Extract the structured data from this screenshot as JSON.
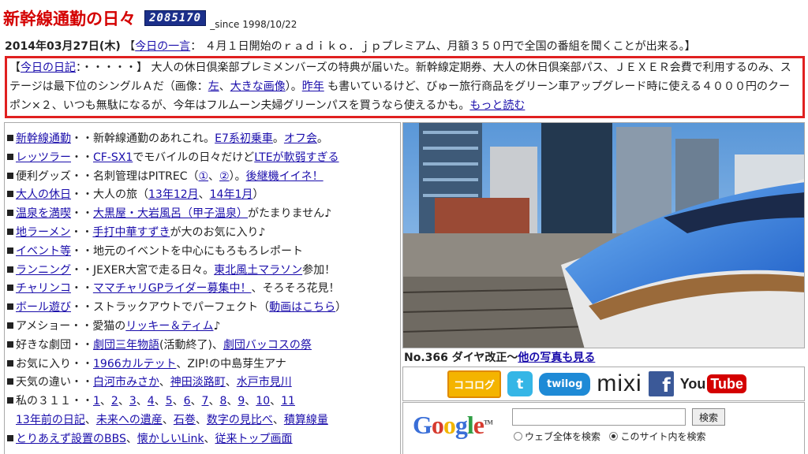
{
  "header": {
    "site_title": "新幹線通勤の日々",
    "counter": "2085170",
    "since": "_since 1998/10/22"
  },
  "today_line": {
    "date": "2014年03月27日(木)",
    "open": "【",
    "phrase_link": "今日の一言",
    "phrase_text": "： ４月１日開始のｒａｄｉｋｏ．ｊｐプレミアム、月額３５０円で全国の番組を聞くことが出来る。】"
  },
  "diary": {
    "open": "【",
    "link": "今日の日記",
    "p1": "：・・・・・】 大人の休日倶楽部プレミメンバーズの特典が届いた。新幹線定期券、大人の休日倶楽部パス、ＪＥＸＥＲ会費で利用するのみ、ステージは最下位のシングルＡだ（画像：",
    "img_left": "左",
    "sep": "、",
    "img_big": "大きな画像",
    "p2": "）。",
    "last_year": "昨年",
    "p3": " も書いているけど、びゅー旅行商品をグリーン車アップグレード時に使える４０００円のクーポン×２、いつも無駄になるが、今年はフルムーン夫婦グリーンパスを買うなら使えるかも。",
    "more": "もっと読む"
  },
  "menu": [
    {
      "label": "新幹線通勤",
      "label_link": true,
      "parts": [
        {
          "t": "・・新幹線通勤のあれこれ。"
        },
        {
          "t": "E7系初乗車",
          "l": true
        },
        {
          "t": "。"
        },
        {
          "t": "オフ会",
          "l": true
        },
        {
          "t": "。"
        }
      ]
    },
    {
      "label": "レッツラー",
      "label_link": true,
      "parts": [
        {
          "t": "・・"
        },
        {
          "t": "CF-SX1",
          "l": true
        },
        {
          "t": "でモバイルの日々だけど"
        },
        {
          "t": "LTEが軟弱すぎる",
          "l": true
        }
      ]
    },
    {
      "label": "便利グッズ",
      "label_link": false,
      "parts": [
        {
          "t": "・・名刺管理はPITREC（"
        },
        {
          "t": "①",
          "l": true
        },
        {
          "t": "、"
        },
        {
          "t": "②",
          "l": true
        },
        {
          "t": "）。"
        },
        {
          "t": "後継機イイネ！",
          "l": true
        }
      ]
    },
    {
      "label": "大人の休日",
      "label_link": true,
      "parts": [
        {
          "t": "・・大人の旅（"
        },
        {
          "t": "13年12月",
          "l": true
        },
        {
          "t": "、"
        },
        {
          "t": "14年1月",
          "l": true
        },
        {
          "t": "）"
        }
      ]
    },
    {
      "label": "温泉を満喫",
      "label_link": true,
      "parts": [
        {
          "t": "・・"
        },
        {
          "t": "大黒屋・大岩風呂（甲子温泉）",
          "l": true
        },
        {
          "t": "がたまりません♪"
        }
      ]
    },
    {
      "label": "地ラーメン",
      "label_link": true,
      "parts": [
        {
          "t": "・・"
        },
        {
          "t": "手打中華すずき",
          "l": true
        },
        {
          "t": "が大のお気に入り♪"
        }
      ]
    },
    {
      "label": "イベント等",
      "label_link": true,
      "parts": [
        {
          "t": "・・地元のイベントを中心にもろもろレポート"
        }
      ]
    },
    {
      "label": "ランニング",
      "label_link": true,
      "parts": [
        {
          "t": "・・JEXER大宮で走る日々。"
        },
        {
          "t": "東北風土マラソン",
          "l": true
        },
        {
          "t": "参加！"
        }
      ]
    },
    {
      "label": "チャリンコ",
      "label_link": true,
      "parts": [
        {
          "t": "・・"
        },
        {
          "t": "ママチャリGPライダー募集中！",
          "l": true
        },
        {
          "t": "、そろそろ花見！"
        }
      ]
    },
    {
      "label": "ボール遊び",
      "label_link": true,
      "parts": [
        {
          "t": "・・ストラックアウトでパーフェクト（"
        },
        {
          "t": "動画はこちら",
          "l": true
        },
        {
          "t": "）"
        }
      ]
    },
    {
      "label": "アメショー",
      "label_link": false,
      "parts": [
        {
          "t": "・・愛猫の"
        },
        {
          "t": "リッキー＆ティム",
          "l": true
        },
        {
          "t": "♪"
        }
      ]
    },
    {
      "label": "好きな劇団",
      "label_link": false,
      "parts": [
        {
          "t": "・・"
        },
        {
          "t": "劇団三年物語",
          "l": true
        },
        {
          "t": "(活動終了)、"
        },
        {
          "t": "劇団バッコスの祭",
          "l": true
        }
      ]
    },
    {
      "label": "お気に入り",
      "label_link": false,
      "parts": [
        {
          "t": "・・"
        },
        {
          "t": "1966カルテット",
          "l": true
        },
        {
          "t": "、ZIP!の中島芽生アナ"
        }
      ]
    },
    {
      "label": "天気の違い",
      "label_link": false,
      "parts": [
        {
          "t": "・・"
        },
        {
          "t": "白河市みさか",
          "l": true
        },
        {
          "t": "、"
        },
        {
          "t": "神田淡路町",
          "l": true
        },
        {
          "t": "、"
        },
        {
          "t": "水戸市見川",
          "l": true
        }
      ]
    },
    {
      "label": "私の３１１",
      "label_link": false,
      "parts": [
        {
          "t": "・・"
        },
        {
          "t": "1",
          "l": true
        },
        {
          "t": "、"
        },
        {
          "t": "2",
          "l": true
        },
        {
          "t": "、"
        },
        {
          "t": "3",
          "l": true
        },
        {
          "t": "、"
        },
        {
          "t": "4",
          "l": true
        },
        {
          "t": "、"
        },
        {
          "t": "5",
          "l": true
        },
        {
          "t": "、"
        },
        {
          "t": "6",
          "l": true
        },
        {
          "t": "、"
        },
        {
          "t": "7",
          "l": true
        },
        {
          "t": "、"
        },
        {
          "t": "8",
          "l": true
        },
        {
          "t": "、"
        },
        {
          "t": "9",
          "l": true
        },
        {
          "t": "、"
        },
        {
          "t": "10",
          "l": true
        },
        {
          "t": "、"
        },
        {
          "t": "11",
          "l": true
        }
      ]
    },
    {
      "label": "",
      "label_link": false,
      "parts": [
        {
          "t": "13年前の日記",
          "l": true
        },
        {
          "t": "、"
        },
        {
          "t": "未来への遺産",
          "l": true
        },
        {
          "t": "、"
        },
        {
          "t": "石巻",
          "l": true
        },
        {
          "t": "、"
        },
        {
          "t": "数字の見比べ",
          "l": true
        },
        {
          "t": "、"
        },
        {
          "t": "積算線量",
          "l": true
        }
      ]
    },
    {
      "label": "とりあえず設置のBBS",
      "label_link": true,
      "parts": [
        {
          "t": "、"
        },
        {
          "t": "懐かしいLink",
          "l": true
        },
        {
          "t": "、"
        },
        {
          "t": "従来トップ画面",
          "l": true
        }
      ]
    }
  ],
  "photo": {
    "caption_text": "No.366 ダイヤ改正～",
    "caption_link": "他の写真も見る"
  },
  "social": {
    "cocolog": "ココログ",
    "twitter": "t",
    "twilog": "twilog",
    "mixi": "mixi",
    "facebook": "f",
    "youtube_you": "You",
    "youtube_tube": "Tube"
  },
  "search": {
    "logo": "Google",
    "tm": "TM",
    "button": "検索",
    "opt_web": "ウェブ全体を検索",
    "opt_site": "このサイト内を検索",
    "selected": "site"
  }
}
